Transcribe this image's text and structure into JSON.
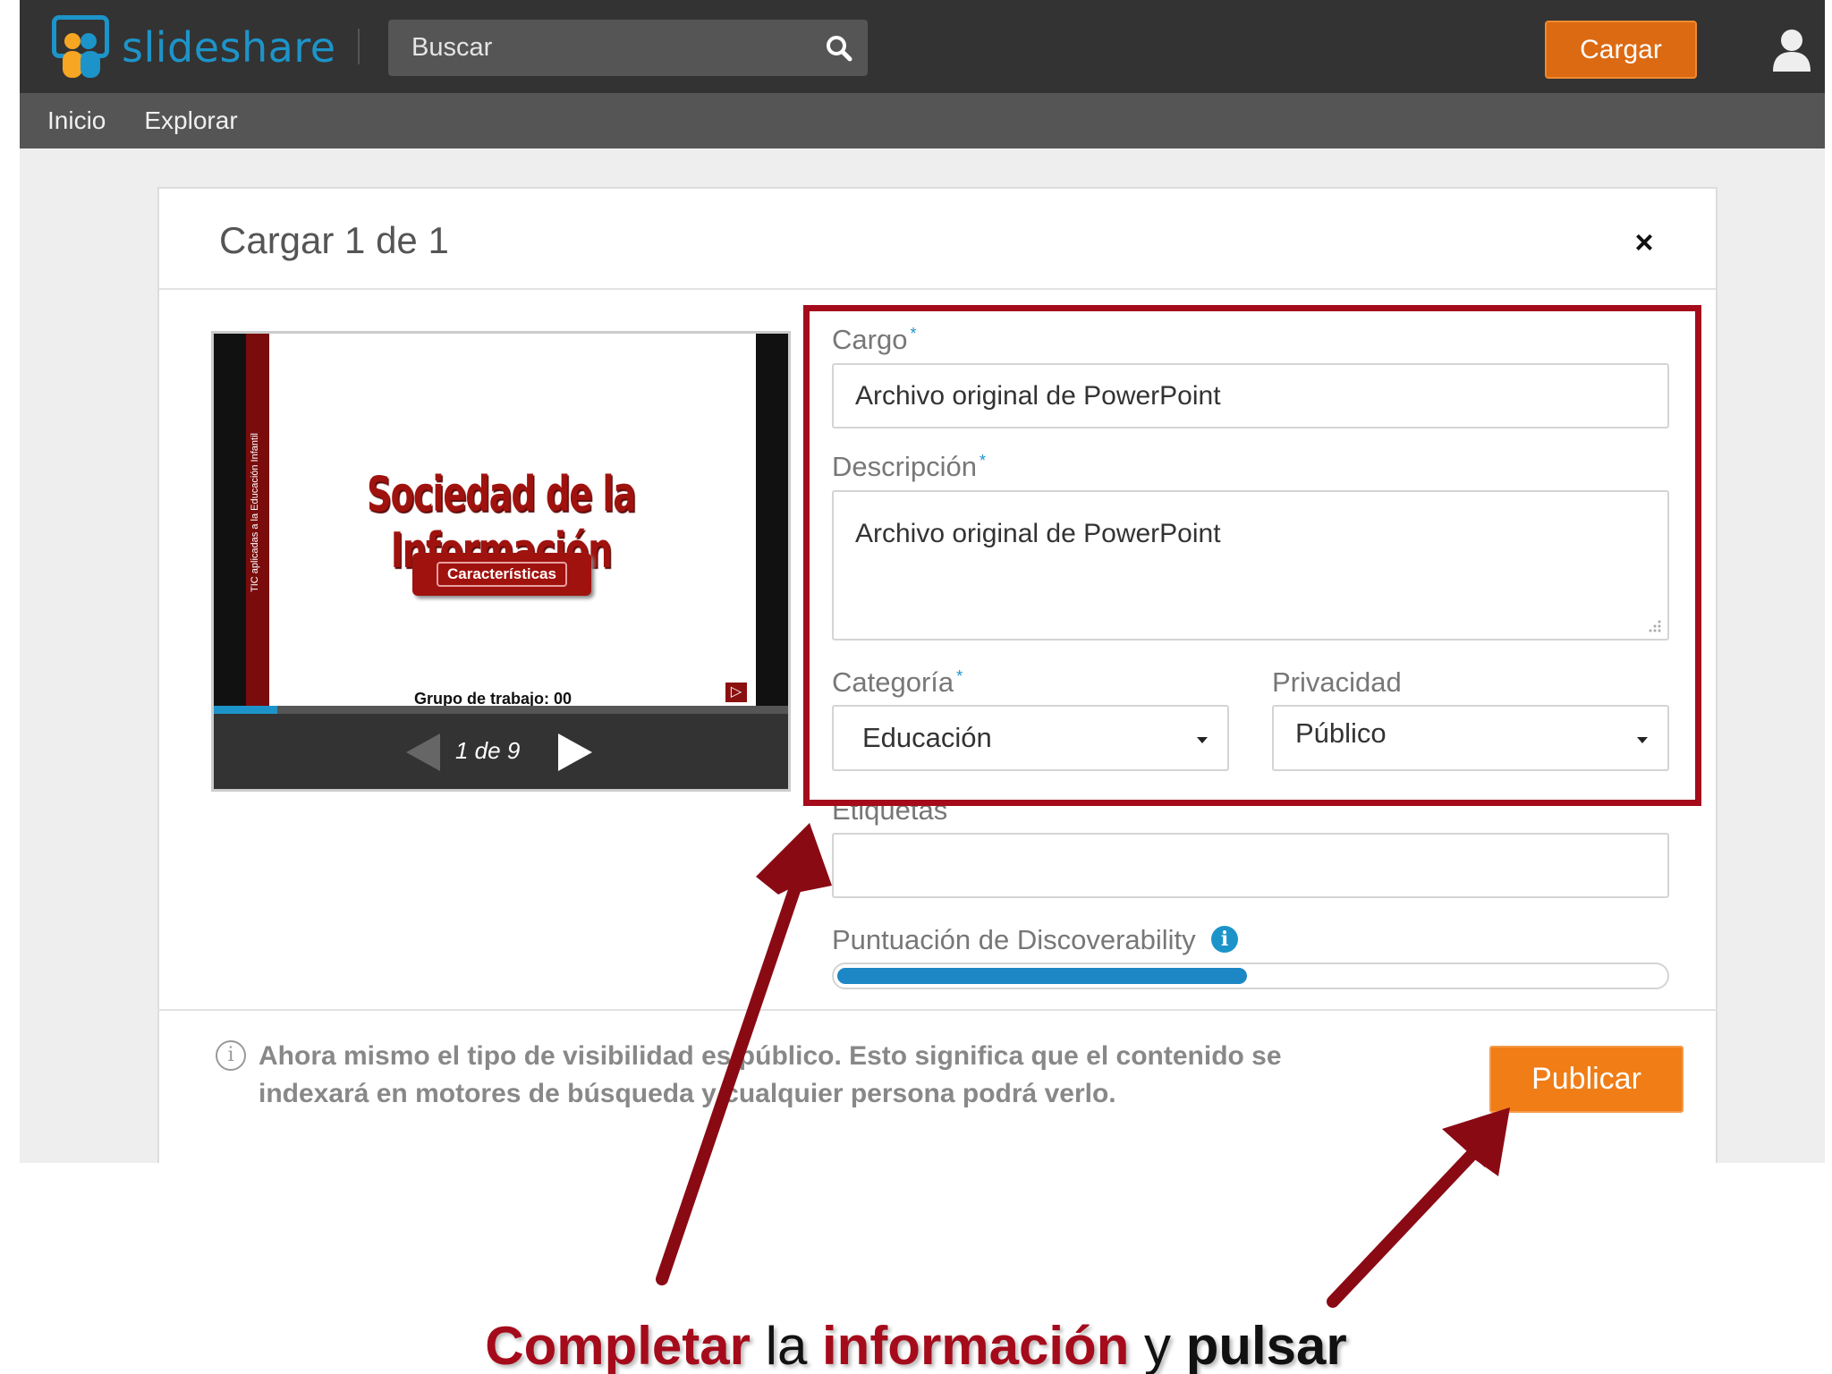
{
  "header": {
    "logo_text": "slideshare",
    "search_placeholder": "Buscar",
    "upload_button": "Cargar",
    "nav": [
      "Inicio",
      "Explorar"
    ]
  },
  "modal": {
    "title": "Cargar 1 de 1",
    "close": "×",
    "preview": {
      "slide_title": "Sociedad de la Información",
      "slide_subtitle": "Características",
      "slide_footer": "Grupo de trabajo: 00",
      "slide_side_text": "TIC aplicadas a la Educación Infantil",
      "page_counter": "1 de 9",
      "progress": 0.11
    },
    "form": {
      "title_label": "Cargo",
      "title_value": "Archivo original de PowerPoint",
      "description_label": "Descripción",
      "description_value": "Archivo original de PowerPoint",
      "category_label": "Categoría",
      "category_value": "Educación",
      "privacy_label": "Privacidad",
      "privacy_value": "Público",
      "tags_label": "Etiquetas",
      "tags_value": "",
      "discoverability_label": "Puntuación de Discoverability",
      "discoverability_score": 0.5,
      "required_marker": "*"
    },
    "notice": "Ahora mismo el tipo de visibilidad es público. Esto significa que el contenido se indexará en motores de búsqueda y cualquier persona podrá verlo.",
    "publish_button": "Publicar"
  },
  "annotation": {
    "word1": "Completar",
    "word2": "la",
    "word3": "información",
    "word4": "y",
    "word5": "pulsar",
    "highlight_color": "#a50b1b"
  },
  "colors": {
    "brand_blue": "#1d94c9",
    "orange": "#f07d16",
    "topbar": "#333333"
  }
}
